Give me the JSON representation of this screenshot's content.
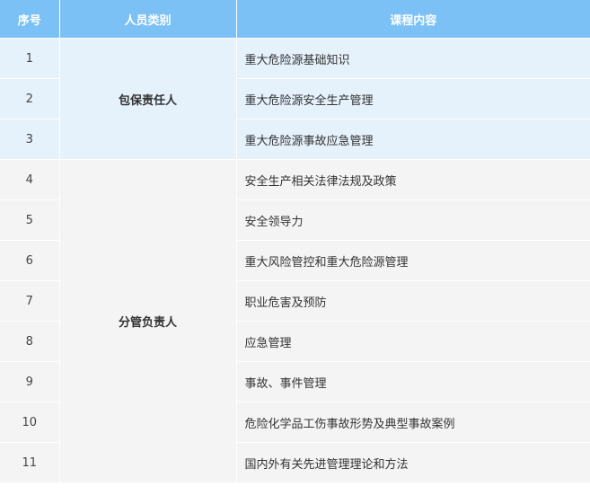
{
  "table": {
    "headers": {
      "no": "序号",
      "type": "人员类别",
      "course": "课程内容"
    },
    "groups": [
      {
        "type": "包保责任人",
        "rows": [
          {
            "no": "1",
            "course": "重大危险源基础知识"
          },
          {
            "no": "2",
            "course": "重大危险源安全生产管理"
          },
          {
            "no": "3",
            "course": "重大危险源事故应急管理"
          }
        ]
      },
      {
        "type": "分管负责人",
        "rows": [
          {
            "no": "4",
            "course": "安全生产相关法律法规及政策"
          },
          {
            "no": "5",
            "course": "安全领导力"
          },
          {
            "no": "6",
            "course": "重大风险管控和重大危险源管理"
          },
          {
            "no": "7",
            "course": "职业危害及预防"
          },
          {
            "no": "8",
            "course": "应急管理"
          },
          {
            "no": "9",
            "course": "事故、事件管理"
          },
          {
            "no": "10",
            "course": "危险化学品工伤事故形势及典型事故案例"
          },
          {
            "no": "11",
            "course": "国内外有关先进管理理论和方法"
          }
        ]
      }
    ]
  },
  "colors": {
    "header_bg": "#7cc1f6",
    "group1_bg": "#e5f1fb",
    "group2_bg": "#f4f4f4"
  }
}
